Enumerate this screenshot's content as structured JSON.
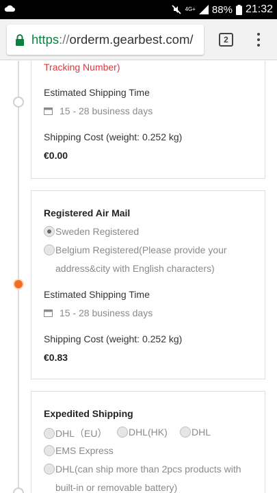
{
  "status_bar": {
    "network": "4G+",
    "battery": "88%",
    "time": "21:32"
  },
  "browser": {
    "url_scheme": "https",
    "url_sep": "://",
    "url_host": "orderm.gearbest.com/",
    "tab_count": "2"
  },
  "card1": {
    "tracking_note": "Tracking Number)",
    "est_label": "Estimated Shipping Time",
    "est_days": "15 - 28 business days",
    "cost_label": "Shipping Cost (weight: 0.252 kg)",
    "cost": "€0.00"
  },
  "card2": {
    "title": "Registered Air Mail",
    "options": [
      {
        "label": "Sweden Registered",
        "selected": true
      },
      {
        "label": "Belgium Registered(Please provide your",
        "label_cont": "address&city with English characters)",
        "selected": false
      }
    ],
    "est_label": "Estimated Shipping Time",
    "est_days": "15 - 28 business days",
    "cost_label": "Shipping Cost (weight: 0.252 kg)",
    "cost": "€0.83"
  },
  "card3": {
    "title": "Expedited Shipping",
    "options": [
      {
        "label": "DHL（EU）",
        "selected": false
      },
      {
        "label": "DHL(HK)",
        "selected": false
      },
      {
        "label": "DHL",
        "selected": false
      },
      {
        "label": "EMS Express",
        "selected": false
      },
      {
        "label": "DHL(can ship more than 2pcs products with",
        "label_cont": "built-in or removable battery)",
        "selected": false
      }
    ]
  },
  "colors": {
    "accent": "#f26f21",
    "secure": "#0b8043",
    "tracking_red": "#d9393f"
  }
}
